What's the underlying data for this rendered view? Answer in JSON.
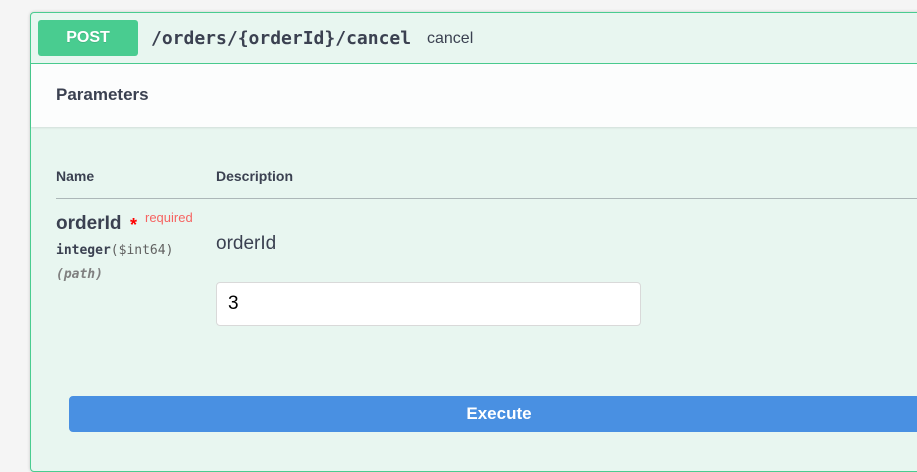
{
  "operation": {
    "method": "POST",
    "path": "/orders/{orderId}/cancel",
    "summary": "cancel"
  },
  "parameters_section": {
    "title": "Parameters",
    "columns": {
      "name": "Name",
      "description": "Description"
    },
    "items": [
      {
        "name": "orderId",
        "required_marker": "*",
        "required_label": "required",
        "type": "integer",
        "format": "($int64)",
        "in": "(path)",
        "description": "orderId",
        "value": "3"
      }
    ]
  },
  "actions": {
    "execute_label": "Execute"
  },
  "colors": {
    "post_accent": "#49cc90",
    "post_background": "#e8f6f0",
    "execute_blue": "#4990e2",
    "required_red": "#ff0000",
    "text_dark": "#3b4151"
  }
}
